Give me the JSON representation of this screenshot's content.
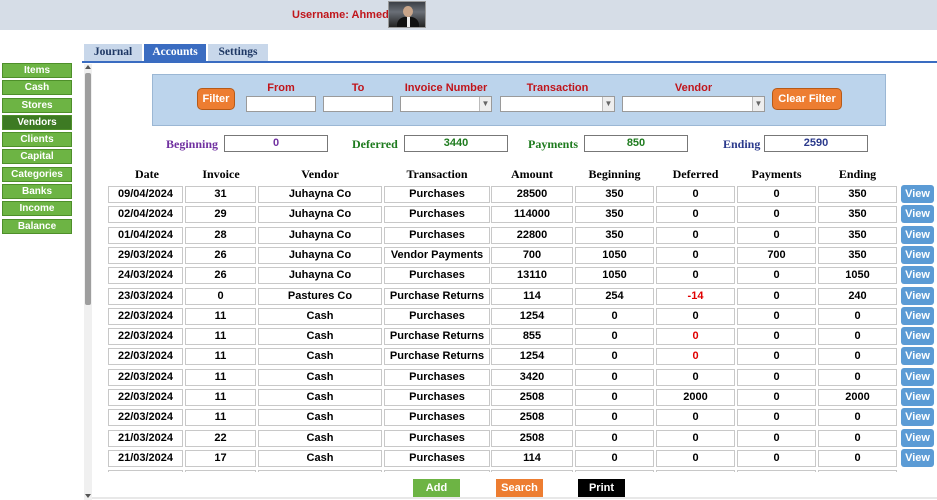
{
  "header": {
    "username_text": "Username: Ahmed",
    "avatar_icon": "user-photo-icon"
  },
  "sidebar": {
    "items": [
      {
        "label": "Items"
      },
      {
        "label": "Cash"
      },
      {
        "label": "Stores"
      },
      {
        "label": "Vendors"
      },
      {
        "label": "Clients"
      },
      {
        "label": "Capital"
      },
      {
        "label": "Categories"
      },
      {
        "label": "Banks"
      },
      {
        "label": "Income"
      },
      {
        "label": "Balance"
      }
    ]
  },
  "tabs": [
    {
      "label": "Journal"
    },
    {
      "label": "Accounts"
    },
    {
      "label": "Settings"
    }
  ],
  "filter": {
    "filter_button": "Filter",
    "from_label": "From",
    "to_label": "To",
    "invoice_label": "Invoice Number",
    "transaction_label": "Transaction",
    "vendor_label": "Vendor",
    "clear_button": "Clear Filter",
    "from_value": "",
    "to_value": "",
    "invoice_value": "",
    "transaction_value": "",
    "vendor_value": ""
  },
  "summary": {
    "beginning_label": "Beginning",
    "beginning_value": "0",
    "deferred_label": "Deferred",
    "deferred_value": "3440",
    "payments_label": "Payments",
    "payments_value": "850",
    "ending_label": "Ending",
    "ending_value": "2590"
  },
  "colors": {
    "green": "#6db444",
    "orange": "#ed7d31",
    "blue": "#5b9bd5",
    "red": "#c0151b",
    "purple": "#7030a0",
    "dark_green": "#1e7b1e",
    "navy": "#2b3a8c"
  },
  "table": {
    "columns": [
      "Date",
      "Invoice",
      "Vendor",
      "Transaction",
      "Amount",
      "Beginning",
      "Deferred",
      "Payments",
      "Ending"
    ],
    "view_label": "View",
    "rows": [
      {
        "date": "09/04/2024",
        "invoice": "31",
        "vendor": "Juhayna Co",
        "transaction": "Purchases",
        "amount": "28500",
        "beginning": "350",
        "deferred": "0",
        "payments": "0",
        "ending": "350"
      },
      {
        "date": "02/04/2024",
        "invoice": "29",
        "vendor": "Juhayna Co",
        "transaction": "Purchases",
        "amount": "114000",
        "beginning": "350",
        "deferred": "0",
        "payments": "0",
        "ending": "350"
      },
      {
        "date": "01/04/2024",
        "invoice": "28",
        "vendor": "Juhayna Co",
        "transaction": "Purchases",
        "amount": "22800",
        "beginning": "350",
        "deferred": "0",
        "payments": "0",
        "ending": "350"
      },
      {
        "date": "29/03/2024",
        "invoice": "26",
        "vendor": "Juhayna Co",
        "transaction": "Vendor Payments",
        "amount": "700",
        "beginning": "1050",
        "deferred": "0",
        "payments": "700",
        "ending": "350"
      },
      {
        "date": "24/03/2024",
        "invoice": "26",
        "vendor": "Juhayna Co",
        "transaction": "Purchases",
        "amount": "13110",
        "beginning": "1050",
        "deferred": "0",
        "payments": "0",
        "ending": "1050"
      },
      {
        "date": "23/03/2024",
        "invoice": "0",
        "vendor": "Pastures Co",
        "transaction": "Purchase Returns",
        "amount": "114",
        "beginning": "254",
        "deferred": "-14",
        "payments": "0",
        "ending": "240",
        "deferred_red": true
      },
      {
        "date": "22/03/2024",
        "invoice": "11",
        "vendor": "Cash",
        "transaction": "Purchases",
        "amount": "1254",
        "beginning": "0",
        "deferred": "0",
        "payments": "0",
        "ending": "0"
      },
      {
        "date": "22/03/2024",
        "invoice": "11",
        "vendor": "Cash",
        "transaction": "Purchase Returns",
        "amount": "855",
        "beginning": "0",
        "deferred": "0",
        "payments": "0",
        "ending": "0",
        "deferred_red": true
      },
      {
        "date": "22/03/2024",
        "invoice": "11",
        "vendor": "Cash",
        "transaction": "Purchase Returns",
        "amount": "1254",
        "beginning": "0",
        "deferred": "0",
        "payments": "0",
        "ending": "0",
        "deferred_red": true
      },
      {
        "date": "22/03/2024",
        "invoice": "11",
        "vendor": "Cash",
        "transaction": "Purchases",
        "amount": "3420",
        "beginning": "0",
        "deferred": "0",
        "payments": "0",
        "ending": "0"
      },
      {
        "date": "22/03/2024",
        "invoice": "11",
        "vendor": "Cash",
        "transaction": "Purchases",
        "amount": "2508",
        "beginning": "0",
        "deferred": "2000",
        "payments": "0",
        "ending": "2000"
      },
      {
        "date": "22/03/2024",
        "invoice": "11",
        "vendor": "Cash",
        "transaction": "Purchases",
        "amount": "2508",
        "beginning": "0",
        "deferred": "0",
        "payments": "0",
        "ending": "0"
      },
      {
        "date": "21/03/2024",
        "invoice": "22",
        "vendor": "Cash",
        "transaction": "Purchases",
        "amount": "2508",
        "beginning": "0",
        "deferred": "0",
        "payments": "0",
        "ending": "0"
      },
      {
        "date": "21/03/2024",
        "invoice": "17",
        "vendor": "Cash",
        "transaction": "Purchases",
        "amount": "114",
        "beginning": "0",
        "deferred": "0",
        "payments": "0",
        "ending": "0"
      }
    ]
  },
  "footer": {
    "add_label": "Add",
    "search_label": "Search",
    "print_label": "Print"
  }
}
